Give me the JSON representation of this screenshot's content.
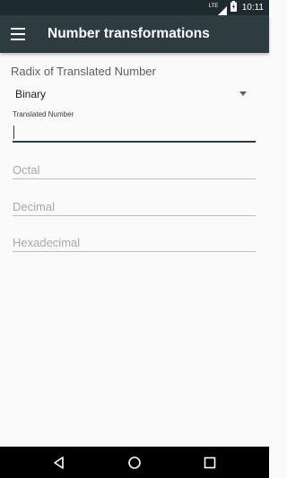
{
  "status_bar": {
    "network_type": "LTE",
    "time": "10:11",
    "icons": [
      "signal-icon",
      "battery-icon"
    ]
  },
  "app_bar": {
    "title": "Number transformations",
    "menu_icon": "hamburger-menu-icon"
  },
  "form": {
    "radix_label": "Radix of Translated Number",
    "radix_selected": "Binary",
    "translated_label": "Translated Number",
    "translated_value": "",
    "octal_placeholder": "Octal",
    "decimal_placeholder": "Decimal",
    "hexadecimal_placeholder": "Hexadecimal"
  },
  "nav_bar": {
    "icons": [
      "back-icon",
      "home-icon",
      "recents-icon"
    ]
  },
  "colors": {
    "app_bar": "#2e3b3f",
    "status_bar": "#1f2a2e",
    "background": "#fafafa",
    "accent": "#2e3b3f"
  }
}
